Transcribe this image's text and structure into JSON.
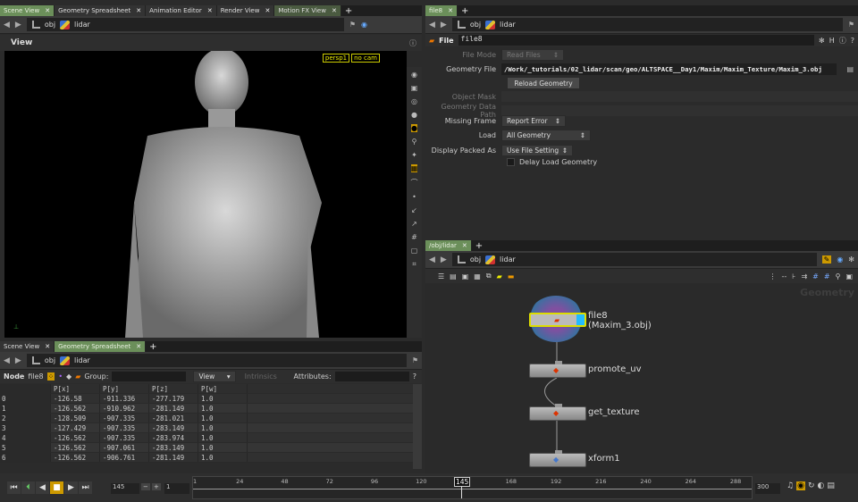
{
  "left_tabs": [
    "Scene View",
    "Geometry Spreadsheet",
    "Animation Editor",
    "Render View",
    "Motion FX View"
  ],
  "path": {
    "obj": "obj",
    "node": "lidar"
  },
  "viewport": {
    "title": "View",
    "camera": "persp1",
    "cam_menu": "no cam"
  },
  "param_tabs": [
    "file8"
  ],
  "params": {
    "type_label": "File",
    "node_name": "file8",
    "file_mode_label": "File Mode",
    "file_mode": "Read Files",
    "geometry_file_label": "Geometry File",
    "geometry_file": "/Work/_tutorials/02_lidar/scan/geo/ALTSPACE__Day1/Maxim/Maxim_Texture/Maxim_3.obj",
    "reload_button": "Reload Geometry",
    "object_mask_label": "Object Mask",
    "geometry_data_path_label": "Geometry Data Path",
    "missing_frame_label": "Missing Frame",
    "missing_frame": "Report Error",
    "load_label": "Load",
    "load": "All Geometry",
    "display_packed_label": "Display Packed As",
    "display_packed": "Use File Setting",
    "delay_load_label": "Delay Load Geometry"
  },
  "network": {
    "tab": "/obj/lidar",
    "context_label": "Geometry",
    "nodes": [
      {
        "name": "file8",
        "sub": "(Maxim_3.obj)"
      },
      {
        "name": "promote_uv"
      },
      {
        "name": "get_texture"
      },
      {
        "name": "xform1"
      }
    ]
  },
  "sheet_tabs": [
    "Scene View",
    "Geometry Spreadsheet"
  ],
  "sheet": {
    "node_label": "Node",
    "node": "file8",
    "group_label": "Group:",
    "view": "View",
    "intrinsics": "Intrinsics",
    "attributes_label": "Attributes:",
    "columns": [
      "P[x]",
      "P[y]",
      "P[z]",
      "P[w]"
    ],
    "rows": [
      [
        "0",
        "-126.58",
        "-911.336",
        "-277.179",
        "1.0"
      ],
      [
        "1",
        "-126.562",
        "-910.962",
        "-281.149",
        "1.0"
      ],
      [
        "2",
        "-128.509",
        "-907.335",
        "-281.021",
        "1.0"
      ],
      [
        "3",
        "-127.429",
        "-907.335",
        "-283.149",
        "1.0"
      ],
      [
        "4",
        "-126.562",
        "-907.335",
        "-283.974",
        "1.0"
      ],
      [
        "5",
        "-126.562",
        "-907.061",
        "-283.149",
        "1.0"
      ],
      [
        "6",
        "-126.562",
        "-906.761",
        "-281.149",
        "1.0"
      ]
    ]
  },
  "timeline": {
    "current_frame": "145",
    "step": "1",
    "end_frame": "300",
    "current_marker": "145",
    "ticks": [
      "1",
      "24",
      "48",
      "72",
      "96",
      "120",
      "168",
      "192",
      "216",
      "240",
      "264",
      "288"
    ]
  }
}
